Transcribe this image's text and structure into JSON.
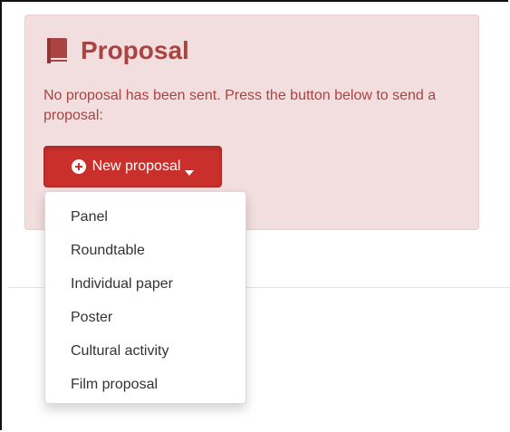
{
  "alert": {
    "title": "Proposal",
    "message": "No proposal has been sent. Press the button below to send a proposal:",
    "book_icon": "book-icon",
    "color": "#a94442",
    "background": "#f2dede"
  },
  "button": {
    "label": "New proposal",
    "icons": [
      "plus-circle-icon",
      "caret-down-icon"
    ],
    "color": "#c9302c"
  },
  "dropdown": {
    "items": [
      {
        "label": "Panel"
      },
      {
        "label": "Roundtable"
      },
      {
        "label": "Individual paper"
      },
      {
        "label": "Poster"
      },
      {
        "label": "Cultural activity"
      },
      {
        "label": "Film proposal"
      }
    ]
  }
}
